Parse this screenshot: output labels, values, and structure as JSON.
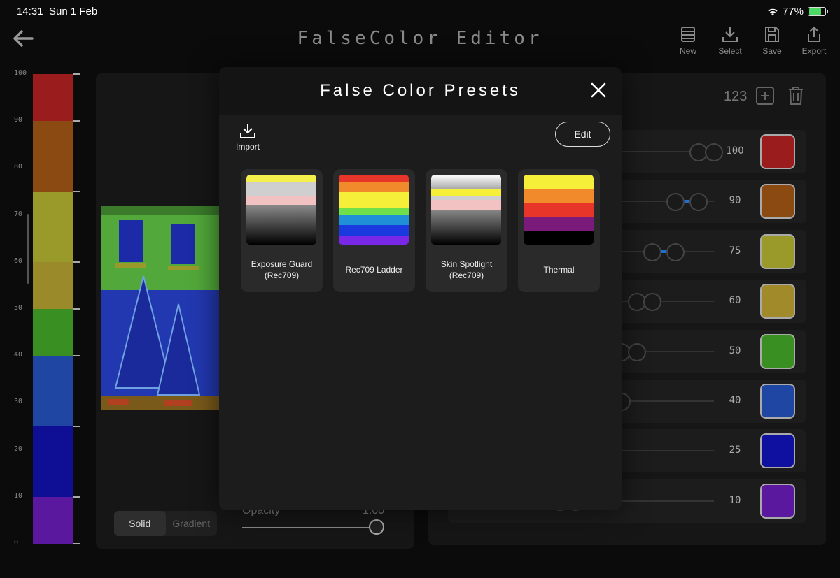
{
  "status": {
    "time": "14:31",
    "date": "Sun 1 Feb",
    "battery": "77%"
  },
  "header": {
    "title": "FalseColor Editor",
    "toolbar": [
      {
        "label": "New",
        "icon": "list-icon"
      },
      {
        "label": "Select",
        "icon": "download-icon"
      },
      {
        "label": "Save",
        "icon": "save-icon"
      },
      {
        "label": "Export",
        "icon": "export-icon"
      }
    ]
  },
  "scale": {
    "labels": [
      "100",
      "90",
      "80",
      "70",
      "60",
      "50",
      "40",
      "30",
      "20",
      "10",
      "0"
    ],
    "bands": [
      {
        "from": 90,
        "to": 100,
        "color": "#9b1c1c"
      },
      {
        "from": 75,
        "to": 90,
        "color": "#8b4a12"
      },
      {
        "from": 60,
        "to": 75,
        "color": "#9a9a2a"
      },
      {
        "from": 50,
        "to": 60,
        "color": "#9a8a2a"
      },
      {
        "from": 40,
        "to": 50,
        "color": "#3a8f23"
      },
      {
        "from": 25,
        "to": 40,
        "color": "#1f46a3"
      },
      {
        "from": 10,
        "to": 25,
        "color": "#0f0f96"
      },
      {
        "from": 0,
        "to": 10,
        "color": "#5a189f"
      }
    ]
  },
  "editor": {
    "mode_options": [
      "Solid",
      "Gradient"
    ],
    "mode_selected": "Solid",
    "opacity_label": "Opacity",
    "opacity_value": "1.00"
  },
  "stops": {
    "count": "123",
    "rows": [
      {
        "value": "100",
        "color": "#9b1c1c",
        "low": 90,
        "high": 100
      },
      {
        "value": "90",
        "color": "#8b4a12",
        "low": 75,
        "high": 90
      },
      {
        "value": "75",
        "color": "#9a9a2a",
        "low": 60,
        "high": 75
      },
      {
        "value": "60",
        "color": "#a08a2a",
        "low": 50,
        "high": 60
      },
      {
        "value": "50",
        "color": "#3a8f23",
        "low": 40,
        "high": 50
      },
      {
        "value": "40",
        "color": "#1f46a3",
        "low": 25,
        "high": 40
      },
      {
        "value": "25",
        "color": "#0f0fa0",
        "low": 10,
        "high": 25
      },
      {
        "value": "10",
        "color": "#5a189f",
        "low": 0,
        "high": 10
      }
    ]
  },
  "modal": {
    "title": "False Color Presets",
    "import_label": "Import",
    "edit_label": "Edit",
    "presets": [
      {
        "name": "Exposure Guard (Rec709)",
        "bands": [
          [
            "#f4ef4a",
            10
          ],
          [
            "#cfcfcf",
            20
          ],
          [
            "#f2c2c2",
            14
          ],
          [
            "grad",
            56
          ]
        ]
      },
      {
        "name": "Rec709 Ladder",
        "bands": [
          [
            "#e8352a",
            10
          ],
          [
            "#f08a2a",
            14
          ],
          [
            "#f6ef3a",
            12
          ],
          [
            "#f6ef3a",
            12
          ],
          [
            "#6fe04a",
            10
          ],
          [
            "#1f8fd8",
            14
          ],
          [
            "#1a3adf",
            16
          ],
          [
            "#7a28e8",
            12
          ]
        ]
      },
      {
        "name": "Skin Spotlight (Rec709)",
        "bands": [
          [
            "grad-top",
            20
          ],
          [
            "#f6ef3a",
            10
          ],
          [
            "#cfcfcf",
            6
          ],
          [
            "#f2c2c2",
            14
          ],
          [
            "grad",
            50
          ]
        ]
      },
      {
        "name": "Thermal",
        "bands": [
          [
            "#f6ef3a",
            20
          ],
          [
            "#f08a2a",
            20
          ],
          [
            "#e8352a",
            20
          ],
          [
            "#7a1a7a",
            20
          ],
          [
            "#000000",
            20
          ]
        ]
      }
    ]
  }
}
